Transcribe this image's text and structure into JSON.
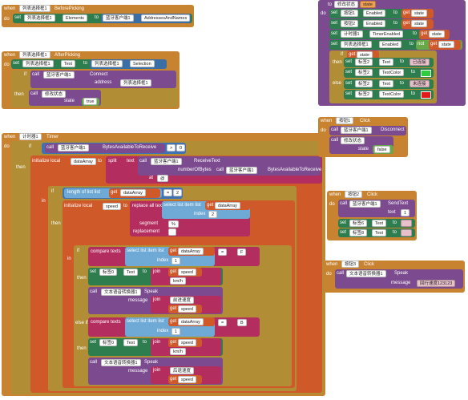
{
  "labels": {
    "when": "when",
    "do": "do",
    "set": "set",
    "to": "to",
    "get": "get",
    "call": "call",
    "then": "then",
    "else": "else",
    "if": "if",
    "not": "not",
    "index": "index",
    "at": "at",
    "in": "in",
    "join": "join",
    "segment": "segment",
    "replacement": "replacement",
    "address": "address",
    "state": "state",
    "message": "message",
    "text": "text",
    "numberOfBytes": "numberOfBytes",
    "else_if": "else if",
    "initialize_local": "initialize local",
    "length_of_list": "length of list  list",
    "select_list_item": "select list item  list",
    "replace_all_text": "replace all text",
    "compare_texts": "compare texts",
    "split": "split",
    "and_eq": "="
  },
  "block_before_picking": {
    "component": "列表选择框1",
    "event": "BeforePicking",
    "target": "列表选择框1",
    "prop": "Elements",
    "src": "蓝牙客户端1",
    "src_prop": "AddressesAndNames"
  },
  "block_after_picking": {
    "component": "列表选择框1",
    "event": "AfterPicking",
    "target": "列表选择框1",
    "prop": "Text",
    "src": "列表选择框1",
    "src_prop": "Selection",
    "if_call": "蓝牙客户端1",
    "method": "Connect",
    "address_src": "列表选择框1",
    "address_prop": "Selection",
    "proc": "修改状态",
    "bool": "true"
  },
  "block_timer": {
    "component": "计时器1",
    "event": "Timer",
    "bt": "蓝牙客户端1",
    "method": "BytesAvailableToReceive",
    "cmp": ">",
    "zero": "0",
    "var": "dataArray",
    "receive": "ReceiveText",
    "sep": "@",
    "at_val": "1",
    "len_cmp": "=",
    "len_val": "2",
    "speed": "speed",
    "replace_segment": "%",
    "replace_replacement": "",
    "index2": "2",
    "cmp1_val": "F",
    "cmp2_val": "B",
    "index1": "1",
    "label": "标签0",
    "tts": "文本语音转换器1",
    "method_speak": "Speak",
    "kmh": "km/h",
    "msg_forward": "前进速度",
    "msg_back": "后退速度"
  },
  "block_proc": {
    "name": "修改状态",
    "param": "state",
    "items": [
      {
        "target": "按钮1",
        "prop": "Enabled",
        "src": "state"
      },
      {
        "target": "按钮2",
        "prop": "Enabled",
        "src": "state"
      },
      {
        "target": "计时器1",
        "prop": "TimerEnabled",
        "src": "state"
      },
      {
        "target": "列表选择框1",
        "prop": "Enabled",
        "not": "not",
        "src": "state"
      }
    ],
    "if_src": "state",
    "then_rows": [
      {
        "target": "标签2",
        "prop": "Text",
        "val": "已连接"
      },
      {
        "target": "标签2",
        "prop": "TextColor"
      }
    ],
    "else_rows": [
      {
        "target": "标签2",
        "prop": "Text",
        "val": "未连接"
      },
      {
        "target": "标签2",
        "prop": "TextColor"
      }
    ]
  },
  "block_btn1": {
    "component": "按钮1",
    "event": "Click",
    "bt": "蓝牙客户端1",
    "method": "Disconnect",
    "proc": "修改状态",
    "bool": "false"
  },
  "block_btn2": {
    "component": "按钮2",
    "event": "Click",
    "bt": "蓝牙客户端1",
    "method": "SendText",
    "text": "1",
    "rows": [
      {
        "target": "标签6",
        "prop": "Text",
        "val": ""
      },
      {
        "target": "标签8",
        "prop": "Text",
        "val": ""
      }
    ]
  },
  "block_btn3": {
    "component": "按钮3",
    "event": "Click",
    "tts": "文本语音转换器1",
    "method": "Speak",
    "msg": "回行速度123123"
  },
  "colors": {
    "event": "#c88330",
    "procedure": "#7b4a8f",
    "set": "#2e7d4f",
    "text": "#b32d5e",
    "list": "#6fa9d6",
    "logic": "#67a848",
    "math": "#3f71b5",
    "variable": "#d0592a",
    "connected": "#2ecc40",
    "disconnected": "#e41a1a"
  }
}
